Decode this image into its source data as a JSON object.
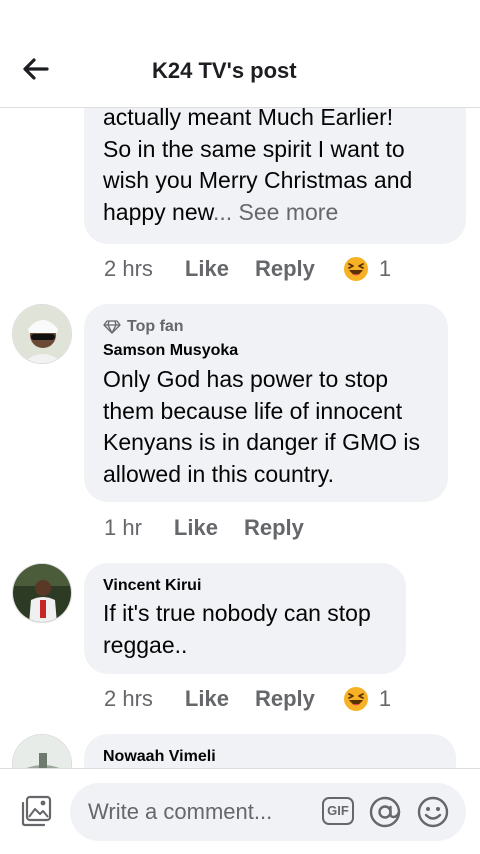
{
  "header": {
    "title": "K24 TV's post"
  },
  "comments": [
    {
      "text": "actually meant Much Earlier!\nSo in the same spirit I want to\nwish you Merry Christmas and\nhappy new",
      "see_more": "... See more",
      "time": "2 hrs",
      "like": "Like",
      "reply": "Reply",
      "reaction_count": "1",
      "reaction_icon": "laughing-emoji-icon"
    },
    {
      "badge": "Top fan",
      "author": "Samson Musyoka",
      "text": "Only God has power to stop\nthem because life of innocent\nKenyans is in danger if GMO is\nallowed in this country.",
      "time": "1 hr",
      "like": "Like",
      "reply": "Reply"
    },
    {
      "author": "Vincent Kirui",
      "text": "If it's true nobody can stop\nreggae..",
      "time": "2 hrs",
      "like": "Like",
      "reply": "Reply",
      "reaction_count": "1",
      "reaction_icon": "laughing-emoji-icon"
    },
    {
      "author": "Nowaah Vimeli"
    }
  ],
  "composer": {
    "placeholder": "Write a comment...",
    "gif_label": "GIF"
  },
  "colors": {
    "bubble": "#f0f2f5",
    "secondary_text": "#65676b",
    "emoji": "#f7b125"
  }
}
